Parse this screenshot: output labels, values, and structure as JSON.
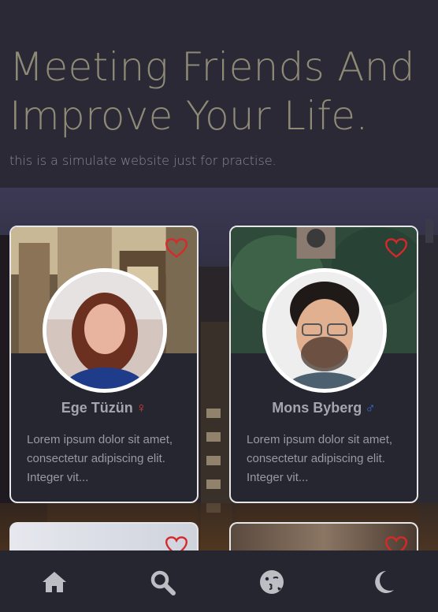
{
  "hero": {
    "title": "Meeting Friends And Improve Your Life.",
    "subtitle": "this is a simulate website just for practise."
  },
  "cards": [
    {
      "name": "Ege Tüzün",
      "gender_symbol": "♀",
      "gender_color": "#d83a3a",
      "description": "Lorem ipsum dolor sit amet, consectetur adipiscing elit. Integer vit..."
    },
    {
      "name": "Mons Byberg",
      "gender_symbol": "♂",
      "gender_color": "#3a6fd8",
      "description": "Lorem ipsum dolor sit amet, consectetur adipiscing elit. Integer vit..."
    }
  ],
  "colors": {
    "heart": "#d82828",
    "title": "#8f8a76",
    "nav_icon": "#bdbdc4"
  },
  "nav": {
    "items": [
      "home-icon",
      "search-icon",
      "kiss-face-icon",
      "moon-icon"
    ]
  }
}
